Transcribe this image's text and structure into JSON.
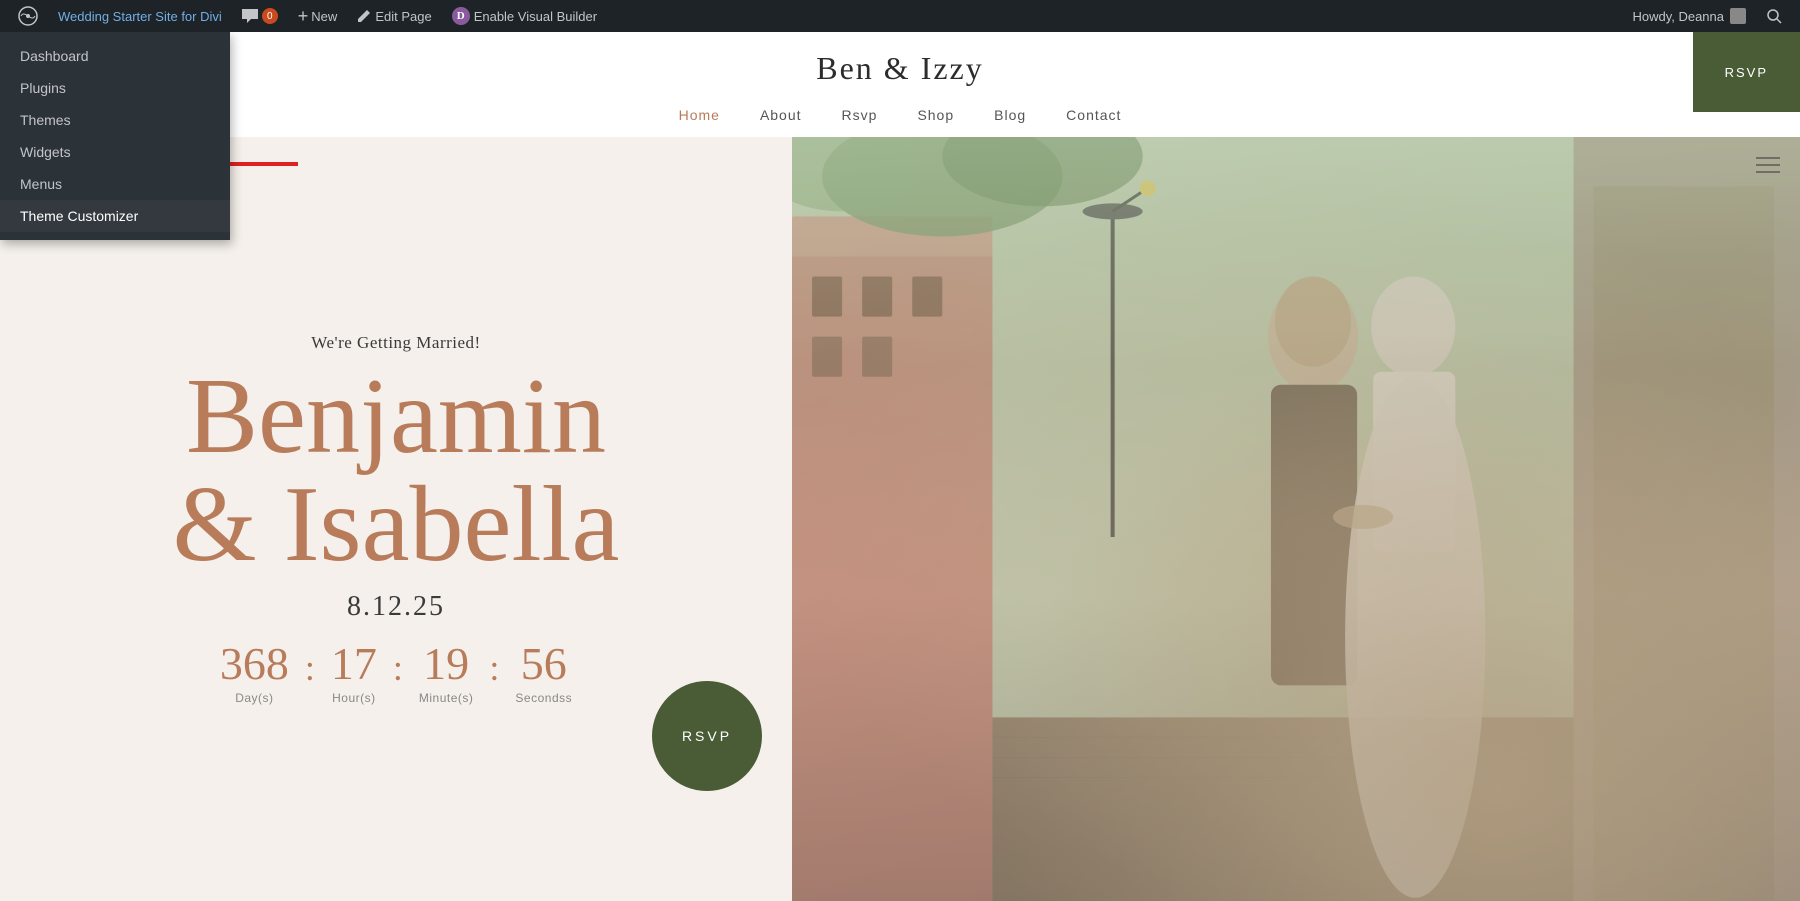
{
  "adminbar": {
    "site_title": "Wedding Starter Site for Divi",
    "comments_label": "Comments",
    "comment_count": "0",
    "new_label": "New",
    "edit_page_label": "Edit Page",
    "visual_builder_label": "Enable Visual Builder",
    "howdy_label": "Howdy, Deanna",
    "search_icon": "search-icon"
  },
  "dropdown": {
    "items": [
      {
        "id": "dashboard",
        "label": "Dashboard"
      },
      {
        "id": "plugins",
        "label": "Plugins"
      },
      {
        "id": "themes",
        "label": "Themes"
      },
      {
        "id": "widgets",
        "label": "Widgets"
      },
      {
        "id": "menus",
        "label": "Menus"
      },
      {
        "id": "theme-customizer",
        "label": "Theme Customizer"
      }
    ]
  },
  "site": {
    "title": "Ben & Izzy",
    "nav": [
      {
        "id": "home",
        "label": "Home",
        "active": true
      },
      {
        "id": "about",
        "label": "About"
      },
      {
        "id": "rsvp",
        "label": "Rsvp"
      },
      {
        "id": "shop",
        "label": "Shop"
      },
      {
        "id": "blog",
        "label": "Blog"
      },
      {
        "id": "contact",
        "label": "Contact"
      }
    ],
    "rsvp_btn": "RSVP"
  },
  "hero": {
    "subtitle": "We're Getting Married!",
    "name_line1": "Benjamin",
    "name_line2": "& Isabella",
    "date": "8.12.25",
    "countdown": [
      {
        "value": "368",
        "label": "Day(s)"
      },
      {
        "value": "17",
        "label": "Hour(s)"
      },
      {
        "value": "19",
        "label": "Minute(s)"
      },
      {
        "value": "56",
        "label": "Seconds()"
      }
    ],
    "rsvp_circle": "RSVP"
  },
  "colors": {
    "accent": "#b87c5a",
    "dark_green": "#4a5c35",
    "admin_bar": "#1d2327",
    "dropdown_bg": "#2c3338",
    "hero_bg": "#f5f0eb"
  }
}
